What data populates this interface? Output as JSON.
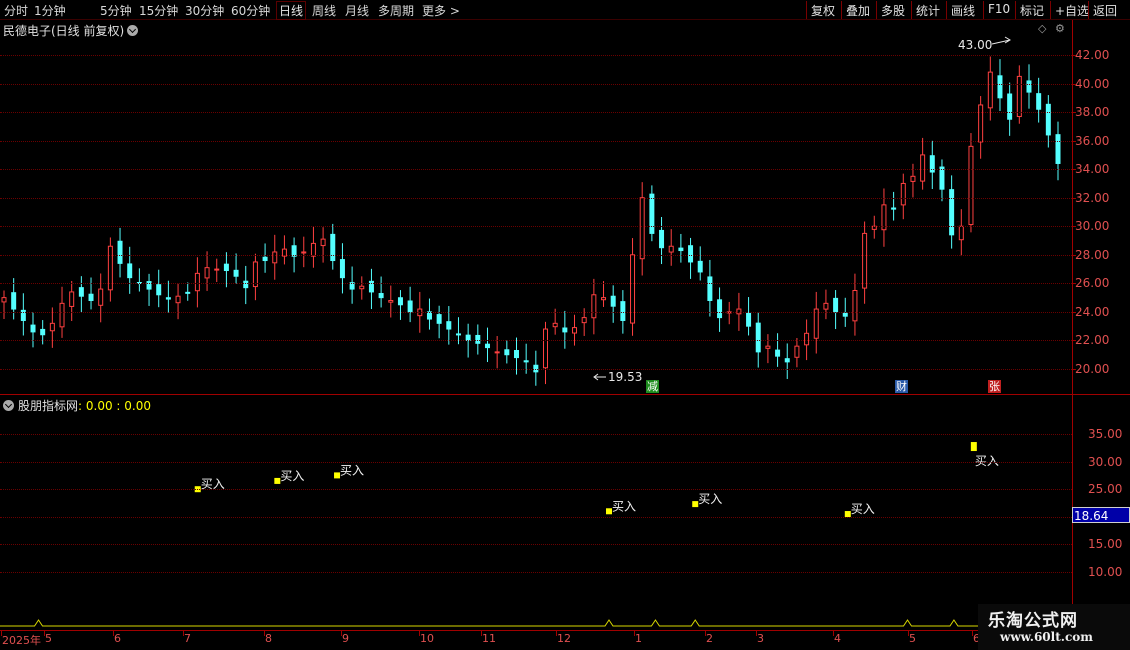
{
  "toolbar": {
    "periods": [
      "分时",
      "1分钟",
      "5分钟",
      "15分钟",
      "30分钟",
      "60分钟",
      "日线",
      "周线",
      "月线",
      "多周期",
      "更多"
    ],
    "active_period": "日线",
    "buttons": [
      "复权",
      "叠加",
      "多股",
      "统计",
      "画线",
      "F10",
      "标记",
      "+自选",
      "返回"
    ]
  },
  "main_chart": {
    "title": "民德电子(日线 前复权)",
    "high_label": "43.00",
    "low_label": "19.53",
    "badges": [
      {
        "text": "减",
        "color": "#1e8c1e"
      },
      {
        "text": "财",
        "color": "#2a5aa8"
      },
      {
        "text": "张",
        "color": "#c02020"
      }
    ],
    "y_ticks": [
      "42.00",
      "40.00",
      "38.00",
      "36.00",
      "34.00",
      "32.00",
      "30.00",
      "28.00",
      "26.00",
      "24.00",
      "22.00",
      "20.00"
    ],
    "up_color": "#ff4040",
    "down_color": "#54ffff"
  },
  "indicator": {
    "title": "股朋指标网",
    "value_text": ": 0.00 : 0.00",
    "y_ticks": [
      "35.00",
      "30.00",
      "25.00",
      "20.00",
      "15.00",
      "10.00"
    ],
    "current_value": "18.64",
    "signal_label": "买入",
    "signal_color": "#ffff00"
  },
  "date_axis": {
    "labels": [
      "2025年",
      "5",
      "6",
      "7",
      "8",
      "9",
      "10",
      "11",
      "12",
      "1",
      "2",
      "3",
      "4",
      "5",
      "6"
    ]
  },
  "watermark": {
    "title": "乐淘公式网",
    "url": "www.60lt.com"
  },
  "chart_data": {
    "type": "candlestick",
    "title": "民德电子(日线 前复权)",
    "y_range": [
      19,
      44
    ],
    "y_ticks": [
      20,
      22,
      24,
      26,
      28,
      30,
      32,
      34,
      36,
      38,
      40,
      42
    ],
    "period_high": 43.0,
    "period_low": 19.53,
    "close_series": [
      25.0,
      24.2,
      23.4,
      22.6,
      22.4,
      23.2,
      24.6,
      25.4,
      25.1,
      24.8,
      25.6,
      28.6,
      27.4,
      26.4,
      26.0,
      25.6,
      25.2,
      24.9,
      25.1,
      25.3,
      26.7,
      27.1,
      27.0,
      26.9,
      26.5,
      25.7,
      27.5,
      27.6,
      28.2,
      28.4,
      27.9,
      28.2,
      28.8,
      29.1,
      27.6,
      26.4,
      25.6,
      25.8,
      25.4,
      25.0,
      24.8,
      24.5,
      24.0,
      24.2,
      23.5,
      23.2,
      22.8,
      22.4,
      22.0,
      21.8,
      21.5,
      21.2,
      21.0,
      20.8,
      20.5,
      19.8,
      22.8,
      23.2,
      22.6,
      22.9,
      23.6,
      25.2,
      25.0,
      24.4,
      23.4,
      28.0,
      32.0,
      29.5,
      28.5,
      28.6,
      28.3,
      27.5,
      26.8,
      24.8,
      23.6,
      24.0,
      24.2,
      23.0,
      21.2,
      21.6,
      20.9,
      20.5,
      21.6,
      22.5,
      24.2,
      24.6,
      24.0,
      23.7,
      25.5,
      29.5,
      30.0,
      31.5,
      31.2,
      33.0,
      33.5,
      35.0,
      33.8,
      32.6,
      29.4,
      30.0,
      35.6,
      38.5,
      40.8,
      39.0,
      37.5,
      40.5,
      39.4,
      38.2,
      36.4,
      34.4
    ],
    "indicator": {
      "name": "股朋指标网",
      "y_range": [
        5,
        40
      ],
      "current_value": 18.64,
      "buy_signals": [
        {
          "date_index": 28,
          "value": 25.0
        },
        {
          "date_index": 40,
          "value": 26.5
        },
        {
          "date_index": 49,
          "value": 27.5
        },
        {
          "date_index": 90,
          "value": 21.0
        },
        {
          "date_index": 103,
          "value": 22.3
        },
        {
          "date_index": 126,
          "value": 20.5
        },
        {
          "date_index": 145,
          "value": 33.0
        }
      ]
    },
    "x_labels": [
      "2025年",
      "5",
      "6",
      "7",
      "8",
      "9",
      "10",
      "11",
      "12",
      "1",
      "2",
      "3",
      "4",
      "5",
      "6"
    ]
  }
}
